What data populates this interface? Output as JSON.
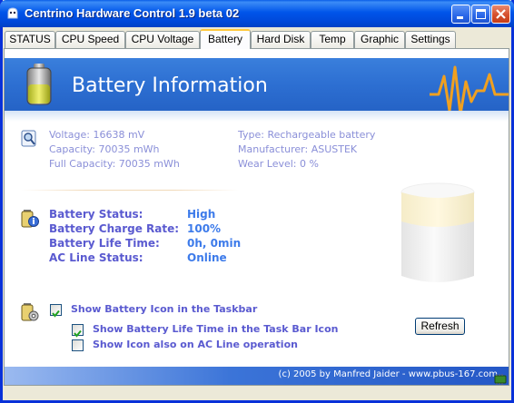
{
  "window": {
    "title": "Centrino Hardware Control 1.9 beta 02",
    "icon": "app-icon",
    "buttons": [
      "minimize-icon",
      "maximize-icon",
      "close-icon"
    ]
  },
  "tabs": [
    {
      "label": "STATUS",
      "active": false
    },
    {
      "label": "CPU Speed",
      "active": false
    },
    {
      "label": "CPU Voltage",
      "active": false
    },
    {
      "label": "Battery",
      "active": true
    },
    {
      "label": "Hard Disk",
      "active": false
    },
    {
      "label": "Temp",
      "active": false
    },
    {
      "label": "Graphic",
      "active": false
    },
    {
      "label": "Settings",
      "active": false
    }
  ],
  "banner": {
    "title": "Battery Information",
    "icon": "battery-icon"
  },
  "info": {
    "voltage": "Voltage:  16638 mV",
    "capacity": "Capacity:  70035 mWh",
    "full_capacity": "Full Capacity:  70035 mWh",
    "type": "Type:  Rechargeable battery",
    "manufacturer": "Manufacturer:  ASUSTEK",
    "wear_level": "Wear Level:  0 %"
  },
  "status": {
    "battery_status_label": "Battery Status:",
    "battery_status_value": "High",
    "charge_rate_label": "Battery Charge Rate:",
    "charge_rate_value": "100%",
    "life_time_label": "Battery Life Time:",
    "life_time_value": "0h, 0min",
    "ac_line_label": "AC Line Status:",
    "ac_line_value": "Online"
  },
  "options": {
    "show_taskbar_icon": {
      "label": "Show Battery Icon in the Taskbar",
      "checked": true
    },
    "show_life_time": {
      "label": "Show Battery Life Time in the Task Bar Icon",
      "checked": true
    },
    "show_on_ac": {
      "label": "Show Icon also on AC Line operation",
      "checked": false
    },
    "refresh_label": "Refresh"
  },
  "footer": {
    "text": "(c) 2005 by Manfred Jaider  -  www.pbus-167.com"
  },
  "colors": {
    "info_text": "#8a8fd8",
    "status_label": "#5a5ad0",
    "status_value": "#3d7bea",
    "banner": "#2d6fd2",
    "pulse": "#f0a020"
  }
}
